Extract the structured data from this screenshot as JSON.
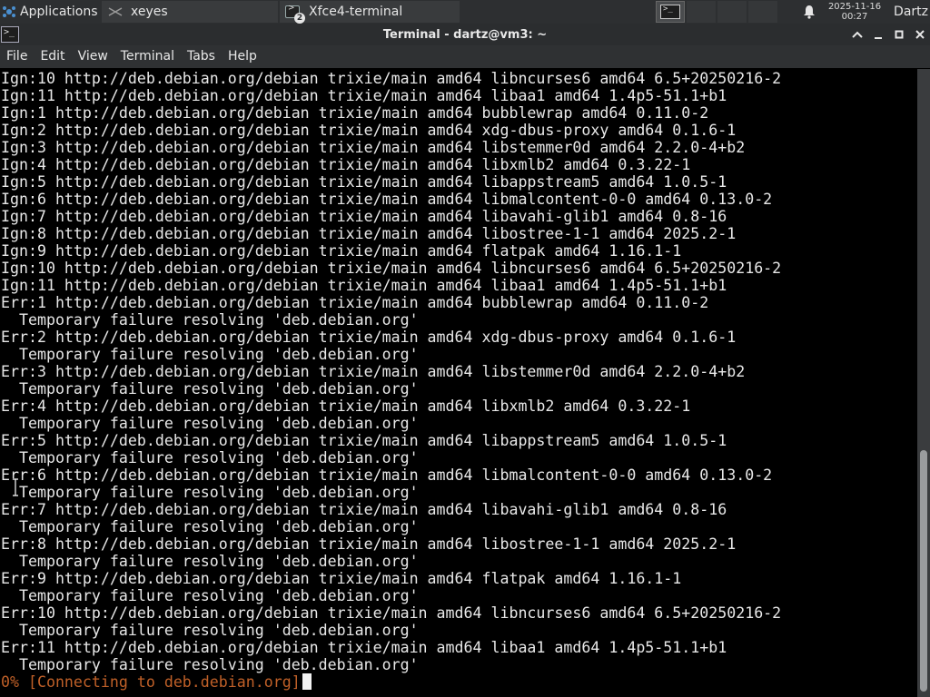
{
  "panel": {
    "apps_label": "Applications",
    "tasks": [
      {
        "label": "xeyes"
      },
      {
        "label": "Xfce4-terminal",
        "badge": "2"
      }
    ],
    "clock_date": "2025-11-16",
    "clock_time": "00:27",
    "user": "Dartz"
  },
  "window": {
    "title": "Terminal - dartz@vm3: ~",
    "controls": {
      "restore": "^",
      "minimize": "–",
      "maximize": "□",
      "close": "✕"
    }
  },
  "menu": {
    "items": [
      "File",
      "Edit",
      "View",
      "Terminal",
      "Tabs",
      "Help"
    ]
  },
  "terminal": {
    "lines": [
      "Ign:10 http://deb.debian.org/debian trixie/main amd64 libncurses6 amd64 6.5+20250216-2",
      "Ign:11 http://deb.debian.org/debian trixie/main amd64 libaa1 amd64 1.4p5-51.1+b1",
      "Ign:1 http://deb.debian.org/debian trixie/main amd64 bubblewrap amd64 0.11.0-2",
      "Ign:2 http://deb.debian.org/debian trixie/main amd64 xdg-dbus-proxy amd64 0.1.6-1",
      "Ign:3 http://deb.debian.org/debian trixie/main amd64 libstemmer0d amd64 2.2.0-4+b2",
      "Ign:4 http://deb.debian.org/debian trixie/main amd64 libxmlb2 amd64 0.3.22-1",
      "Ign:5 http://deb.debian.org/debian trixie/main amd64 libappstream5 amd64 1.0.5-1",
      "Ign:6 http://deb.debian.org/debian trixie/main amd64 libmalcontent-0-0 amd64 0.13.0-2",
      "Ign:7 http://deb.debian.org/debian trixie/main amd64 libavahi-glib1 amd64 0.8-16",
      "Ign:8 http://deb.debian.org/debian trixie/main amd64 libostree-1-1 amd64 2025.2-1",
      "Ign:9 http://deb.debian.org/debian trixie/main amd64 flatpak amd64 1.16.1-1",
      "Ign:10 http://deb.debian.org/debian trixie/main amd64 libncurses6 amd64 6.5+20250216-2",
      "Ign:11 http://deb.debian.org/debian trixie/main amd64 libaa1 amd64 1.4p5-51.1+b1",
      "Err:1 http://deb.debian.org/debian trixie/main amd64 bubblewrap amd64 0.11.0-2",
      "  Temporary failure resolving 'deb.debian.org'",
      "Err:2 http://deb.debian.org/debian trixie/main amd64 xdg-dbus-proxy amd64 0.1.6-1",
      "  Temporary failure resolving 'deb.debian.org'",
      "Err:3 http://deb.debian.org/debian trixie/main amd64 libstemmer0d amd64 2.2.0-4+b2",
      "  Temporary failure resolving 'deb.debian.org'",
      "Err:4 http://deb.debian.org/debian trixie/main amd64 libxmlb2 amd64 0.3.22-1",
      "  Temporary failure resolving 'deb.debian.org'",
      "Err:5 http://deb.debian.org/debian trixie/main amd64 libappstream5 amd64 1.0.5-1",
      "  Temporary failure resolving 'deb.debian.org'",
      "Err:6 http://deb.debian.org/debian trixie/main amd64 libmalcontent-0-0 amd64 0.13.0-2",
      "  Temporary failure resolving 'deb.debian.org'",
      "Err:7 http://deb.debian.org/debian trixie/main amd64 libavahi-glib1 amd64 0.8-16",
      "  Temporary failure resolving 'deb.debian.org'",
      "Err:8 http://deb.debian.org/debian trixie/main amd64 libostree-1-1 amd64 2025.2-1",
      "  Temporary failure resolving 'deb.debian.org'",
      "Err:9 http://deb.debian.org/debian trixie/main amd64 flatpak amd64 1.16.1-1",
      "  Temporary failure resolving 'deb.debian.org'",
      "Err:10 http://deb.debian.org/debian trixie/main amd64 libncurses6 amd64 6.5+20250216-2",
      "  Temporary failure resolving 'deb.debian.org'",
      "Err:11 http://deb.debian.org/debian trixie/main amd64 libaa1 amd64 1.4p5-51.1+b1",
      "  Temporary failure resolving 'deb.debian.org'"
    ],
    "progress_line": "0% [Connecting to deb.debian.org]"
  },
  "colors": {
    "panel_bg": "#2d2f31",
    "terminal_bg": "#000000",
    "terminal_fg": "#e8e8e8",
    "progress_fg": "#c06028"
  }
}
